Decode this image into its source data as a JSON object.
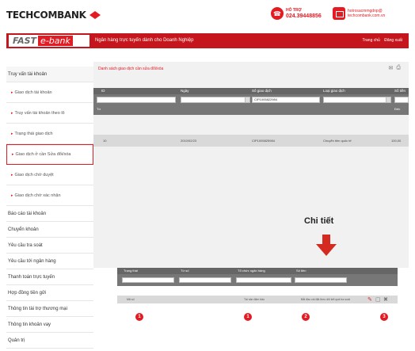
{
  "header": {
    "brand": "TECHCOMBANK",
    "hotline_label": "HỖ TRỢ",
    "hotline_number": "024.39448856",
    "contact_line1": "hotrosacmmgdnp@",
    "contact_line2": "techcombank.com.vn",
    "brand_color": "#e31b23"
  },
  "nav": {
    "fast": "FAST",
    "ebank": "e-bank",
    "tagline": "Ngân hàng trực tuyến dành cho Doanh Nghiệp",
    "links": [
      "Trang chủ",
      "Đăng xuất"
    ]
  },
  "sidebar": {
    "items": [
      {
        "label": "Truy vấn tài khoản",
        "type": "main"
      },
      {
        "label": "Giao dịch tài khoản",
        "type": "sub"
      },
      {
        "label": "Truy vấn tài khoản theo lô",
        "type": "sub"
      },
      {
        "label": "Trạng thái giao dịch",
        "type": "sub"
      },
      {
        "label": "Giao dịch ở cần Sửa đổi/xóa",
        "type": "sub",
        "highlight": true
      },
      {
        "label": "Giao dịch chờ duyệt",
        "type": "sub"
      },
      {
        "label": "Giao dịch chờ xác nhận",
        "type": "sub"
      },
      {
        "label": "Báo cáo tài khoản",
        "type": "main"
      },
      {
        "label": "Chuyển khoản",
        "type": "main"
      },
      {
        "label": "Yêu cầu tra soát",
        "type": "main"
      },
      {
        "label": "Yêu cầu tới ngân hàng",
        "type": "main"
      },
      {
        "label": "Thanh toán trực tuyến",
        "type": "main"
      },
      {
        "label": "Hợp đồng tiền gửi",
        "type": "main"
      },
      {
        "label": "Thông tin tài trợ thương mại",
        "type": "main"
      },
      {
        "label": "Thông tin khoản vay",
        "type": "main"
      },
      {
        "label": "Quản trị",
        "type": "main"
      }
    ]
  },
  "panel": {
    "title": "Danh sách giao dịch cần sửa đổi/xóa",
    "filter_headers": [
      "ID",
      "Ngày",
      "Số giao dịch",
      "Loại giao dịch",
      "Số tiền"
    ],
    "filter_values": [
      "",
      "",
      "CIP1005822984",
      "",
      ""
    ],
    "range_labels": [
      "Từ",
      "Đến"
    ],
    "row": [
      "10",
      "2010/02/23",
      "CIP1005825984",
      "Chuyển tiền quốc tế",
      "100,00"
    ]
  },
  "annotation": {
    "label": "Chi tiết",
    "badges": [
      "1",
      "1",
      "2",
      "3"
    ]
  },
  "mini": {
    "headers": [
      "Trạng thái",
      "Từ số",
      "Tổ chức ngân hàng",
      "Số tiền"
    ],
    "row": [
      "Mã số",
      "Tài sản đảm bảo",
      "Bắt đầu cài đặt theo dõi kết quả tra soát"
    ]
  }
}
